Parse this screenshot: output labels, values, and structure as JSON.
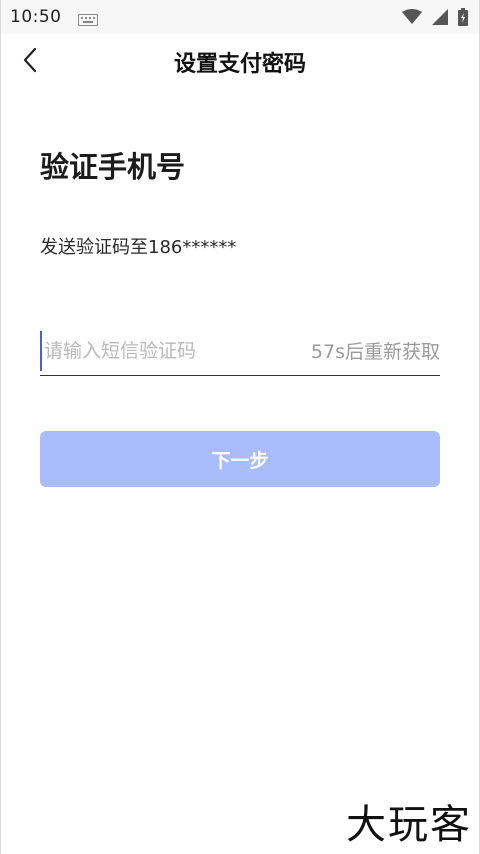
{
  "status_bar": {
    "time": "10:50",
    "icons": [
      "keyboard-icon",
      "wifi-icon",
      "cell-signal-icon",
      "battery-icon"
    ]
  },
  "nav": {
    "back_icon": "chevron-left-icon",
    "title": "设置支付密码"
  },
  "page": {
    "heading": "验证手机号",
    "phone_prefix": "发送验证码至",
    "phone_masked": "186******"
  },
  "code_field": {
    "placeholder": "请输入短信验证码",
    "value": "",
    "resend_countdown": "57s后重新获取"
  },
  "next_button": {
    "label": "下一步",
    "color": "#a9bdfd"
  },
  "watermark": {
    "text": "大玩客"
  }
}
